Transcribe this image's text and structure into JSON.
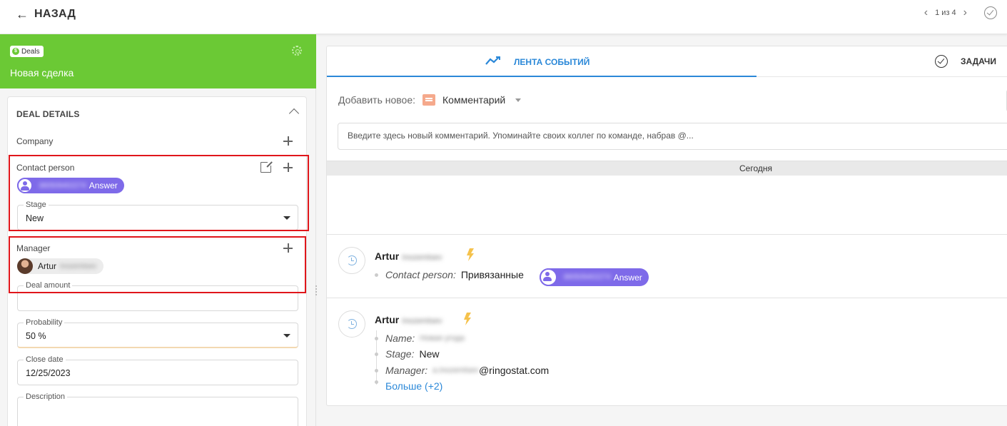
{
  "topbar": {
    "back_label": "НАЗАД",
    "pager_text": "1 из 4"
  },
  "deal": {
    "badge": "Deals",
    "title": "Новая сделка",
    "section_title": "DEAL DETAILS",
    "company_label": "Company",
    "contact_label": "Contact person",
    "contact_phone": "380509402274",
    "contact_tag": "Answer",
    "stage_label": "Stage",
    "stage_value": "New",
    "manager_label": "Manager",
    "manager_first": "Artur",
    "manager_last": "Inozemtsev",
    "amount_label": "Deal amount",
    "amount_value": "",
    "probability_label": "Probability",
    "probability_value": "50 %",
    "close_label": "Close date",
    "close_value": "12/25/2023",
    "description_label": "Description",
    "description_value": ""
  },
  "feed": {
    "tab_events": "ЛЕНТА СОБЫТИЙ",
    "tab_tasks": "ЗАДАЧИ",
    "add_new_label": "Добавить новое:",
    "add_new_kind": "Комментарий",
    "comment_placeholder": "Введите здесь новый комментарий. Упоминайте своих коллег по команде, набрав @...",
    "today_label": "Сегодня",
    "events": [
      {
        "author_first": "Artur",
        "author_last": "Inozemtsev",
        "contact_key": "Contact person:",
        "contact_text": "Привязанные",
        "contact_phone": "380509402274",
        "contact_tag": "Answer"
      },
      {
        "author_first": "Artur",
        "author_last": "Inozemtsev",
        "name_key": "Name:",
        "name_value": "Новая угода",
        "stage_key": "Stage:",
        "stage_value": "New",
        "manager_key": "Manager:",
        "manager_value_hidden": "a.inozemtsev",
        "manager_domain": "@ringostat.com",
        "more_label": "Больше (+2)"
      }
    ]
  },
  "colors": {
    "brand_green": "#6bc935",
    "accent_blue": "#2b88d8",
    "chip_purple": "#7e6ae9",
    "highlight_red": "#e0161b"
  }
}
